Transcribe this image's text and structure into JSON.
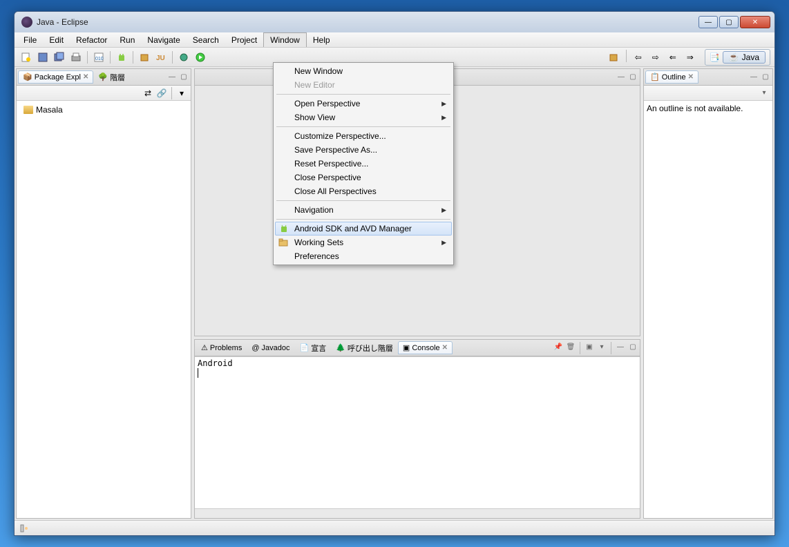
{
  "window": {
    "title": "Java - Eclipse"
  },
  "menubar": {
    "items": [
      "File",
      "Edit",
      "Refactor",
      "Run",
      "Navigate",
      "Search",
      "Project",
      "Window",
      "Help"
    ],
    "active": "Window"
  },
  "perspective": {
    "label": "Java"
  },
  "left": {
    "tabs": [
      {
        "label": "Package Expl",
        "active": true
      },
      {
        "label": "階層",
        "active": false
      }
    ],
    "project": "Masala"
  },
  "right": {
    "tabs": [
      {
        "label": "Outline",
        "active": true
      }
    ],
    "message": "An outline is not available."
  },
  "bottom": {
    "tabs": [
      {
        "label": "Problems",
        "active": false
      },
      {
        "label": "Javadoc",
        "active": false
      },
      {
        "label": "宣言",
        "active": false
      },
      {
        "label": "呼び出し階層",
        "active": false
      },
      {
        "label": "Console",
        "active": true
      }
    ],
    "console_line": "Android"
  },
  "dropdown": {
    "groups": [
      [
        {
          "label": "New Window",
          "disabled": false
        },
        {
          "label": "New Editor",
          "disabled": true
        }
      ],
      [
        {
          "label": "Open Perspective",
          "submenu": true
        },
        {
          "label": "Show View",
          "submenu": true
        }
      ],
      [
        {
          "label": "Customize Perspective..."
        },
        {
          "label": "Save Perspective As..."
        },
        {
          "label": "Reset Perspective..."
        },
        {
          "label": "Close Perspective"
        },
        {
          "label": "Close All Perspectives"
        }
      ],
      [
        {
          "label": "Navigation",
          "submenu": true
        }
      ],
      [
        {
          "label": "Android SDK and AVD Manager",
          "icon": "android",
          "highlighted": true
        },
        {
          "label": "Working Sets",
          "submenu": true,
          "icon": "folder"
        },
        {
          "label": "Preferences"
        }
      ]
    ]
  }
}
